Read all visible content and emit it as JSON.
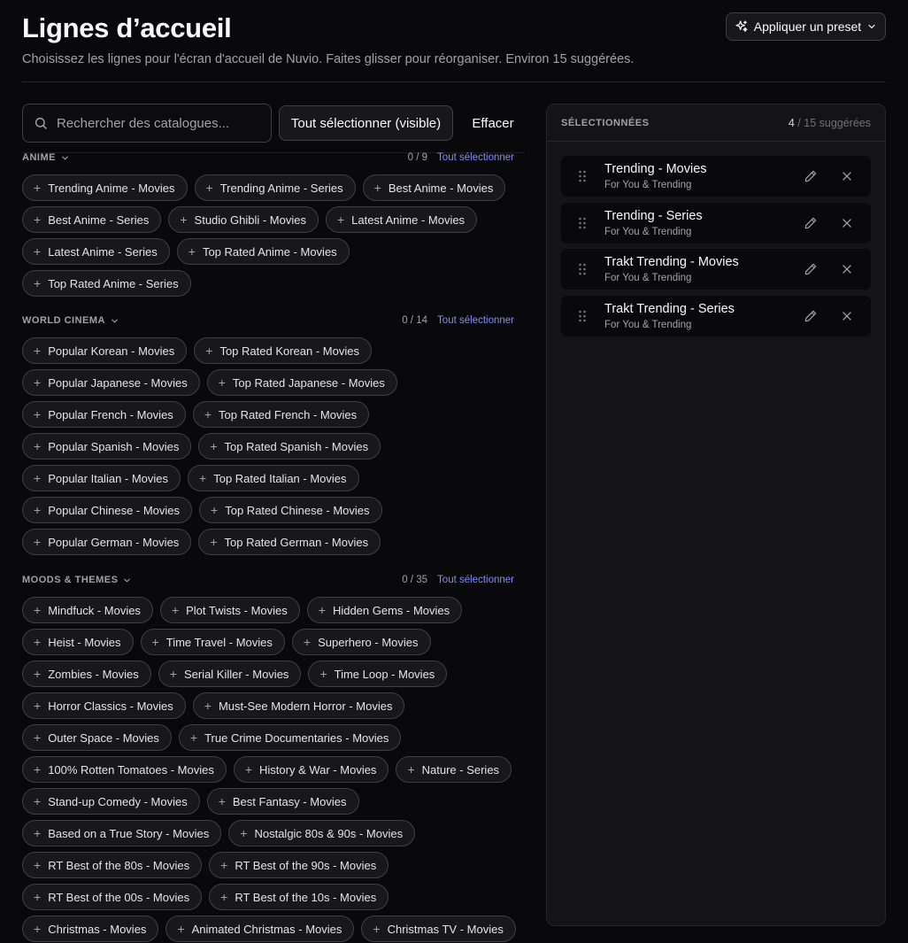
{
  "header": {
    "title": "Lignes d’accueil",
    "subtitle": "Choisissez les lignes pour l'écran d'accueil de Nuvio. Faites glisser pour réorganiser. Environ 15 suggérées.",
    "preset_label": "Appliquer un preset"
  },
  "toolbar": {
    "search_placeholder": "Rechercher des catalogues...",
    "select_all_label": "Tout sélectionner (visible)",
    "clear_label": "Effacer"
  },
  "select_all_link": "Tout sélectionner",
  "sections": [
    {
      "title": "ANIME",
      "count": "0 / 9",
      "rows": [
        [
          "Trending Anime - Movies",
          "Trending Anime - Series",
          "Best Anime - Movies"
        ],
        [
          "Best Anime - Series",
          "Studio Ghibli - Movies",
          "Latest Anime - Movies"
        ],
        [
          "Latest Anime - Series",
          "Top Rated Anime - Movies"
        ],
        [
          "Top Rated Anime - Series"
        ]
      ]
    },
    {
      "title": "WORLD CINEMA",
      "count": "0 / 14",
      "rows": [
        [
          "Popular Korean - Movies",
          "Top Rated Korean - Movies"
        ],
        [
          "Popular Japanese - Movies",
          "Top Rated Japanese - Movies"
        ],
        [
          "Popular French - Movies",
          "Top Rated French - Movies"
        ],
        [
          "Popular Spanish - Movies",
          "Top Rated Spanish - Movies"
        ],
        [
          "Popular Italian - Movies",
          "Top Rated Italian - Movies"
        ],
        [
          "Popular Chinese - Movies",
          "Top Rated Chinese - Movies"
        ],
        [
          "Popular German - Movies",
          "Top Rated German - Movies"
        ]
      ]
    },
    {
      "title": "MOODS & THEMES",
      "count": "0 / 35",
      "rows": [
        [
          "Mindfuck - Movies",
          "Plot Twists - Movies",
          "Hidden Gems - Movies"
        ],
        [
          "Heist - Movies",
          "Time Travel - Movies",
          "Superhero - Movies"
        ],
        [
          "Zombies - Movies",
          "Serial Killer - Movies",
          "Time Loop - Movies"
        ],
        [
          "Horror Classics - Movies",
          "Must-See Modern Horror - Movies"
        ],
        [
          "Outer Space - Movies",
          "True Crime Documentaries - Movies"
        ],
        [
          "100% Rotten Tomatoes - Movies",
          "History & War - Movies",
          "Nature - Series"
        ],
        [
          "Stand-up Comedy - Movies",
          "Best Fantasy - Movies"
        ],
        [
          "Based on a True Story - Movies",
          "Nostalgic 80s & 90s - Movies"
        ],
        [
          "RT Best of the 80s - Movies",
          "RT Best of the 90s - Movies"
        ],
        [
          "RT Best of the 00s - Movies",
          "RT Best of the 10s - Movies"
        ],
        [
          "Christmas - Movies",
          "Animated Christmas - Movies",
          "Christmas TV - Movies"
        ]
      ]
    }
  ],
  "selected_panel": {
    "title": "SÉLECTIONNÉES",
    "count_num": "4",
    "count_rest": " / 15 suggérées",
    "items": [
      {
        "name": "Trending - Movies",
        "source": "For You & Trending"
      },
      {
        "name": "Trending - Series",
        "source": "For You & Trending"
      },
      {
        "name": "Trakt Trending - Movies",
        "source": "For You & Trending"
      },
      {
        "name": "Trakt Trending - Series",
        "source": "For You & Trending"
      }
    ]
  }
}
